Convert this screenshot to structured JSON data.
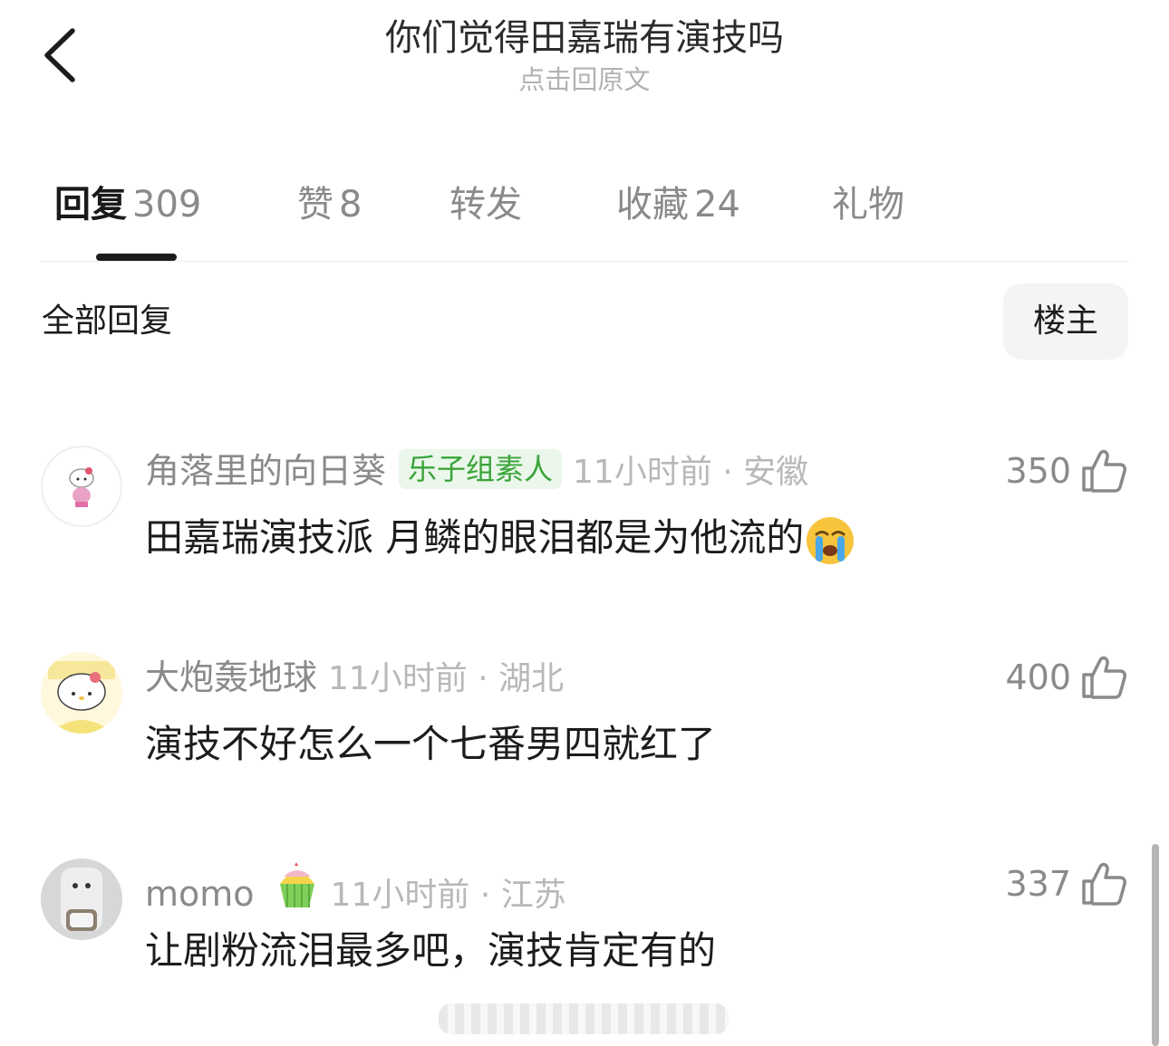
{
  "header": {
    "title": "你们觉得田嘉瑞有演技吗",
    "subtitle": "点击回原文",
    "back_icon": "chevron-left-icon"
  },
  "tabs": [
    {
      "label": "回复",
      "count": "309",
      "active": true
    },
    {
      "label": "赞",
      "count": "8",
      "active": false
    },
    {
      "label": "转发",
      "count": "",
      "active": false
    },
    {
      "label": "收藏",
      "count": "24",
      "active": false
    },
    {
      "label": "礼物",
      "count": "",
      "active": false
    }
  ],
  "section": {
    "title": "全部回复",
    "filter_button": "楼主"
  },
  "comments": [
    {
      "username": "角落里的向日葵",
      "badge": "乐子组素人",
      "time_location": "11小时前 · 安徽",
      "likes": "350",
      "text": "田嘉瑞演技派 月鳞的眼泪都是为他流的",
      "emoji": "loudly-crying-face-icon",
      "avatar": "hello-kitty-avatar"
    },
    {
      "username": "大炮轰地球",
      "badge": "",
      "time_location": "11小时前 · 湖北",
      "likes": "400",
      "text": "演技不好怎么一个七番男四就红了",
      "avatar": "hello-kitty-yellow-avatar"
    },
    {
      "username": "momo",
      "badge_icon": "cupcake-icon",
      "time_location": "11小时前 · 江苏",
      "likes": "337",
      "text": "让剧粉流泪最多吧，演技肯定有的",
      "avatar": "grey-character-avatar"
    }
  ],
  "colors": {
    "accent_dark": "#1c1c1c",
    "muted": "#8a8a8a",
    "badge_green": "#3aa43a"
  }
}
